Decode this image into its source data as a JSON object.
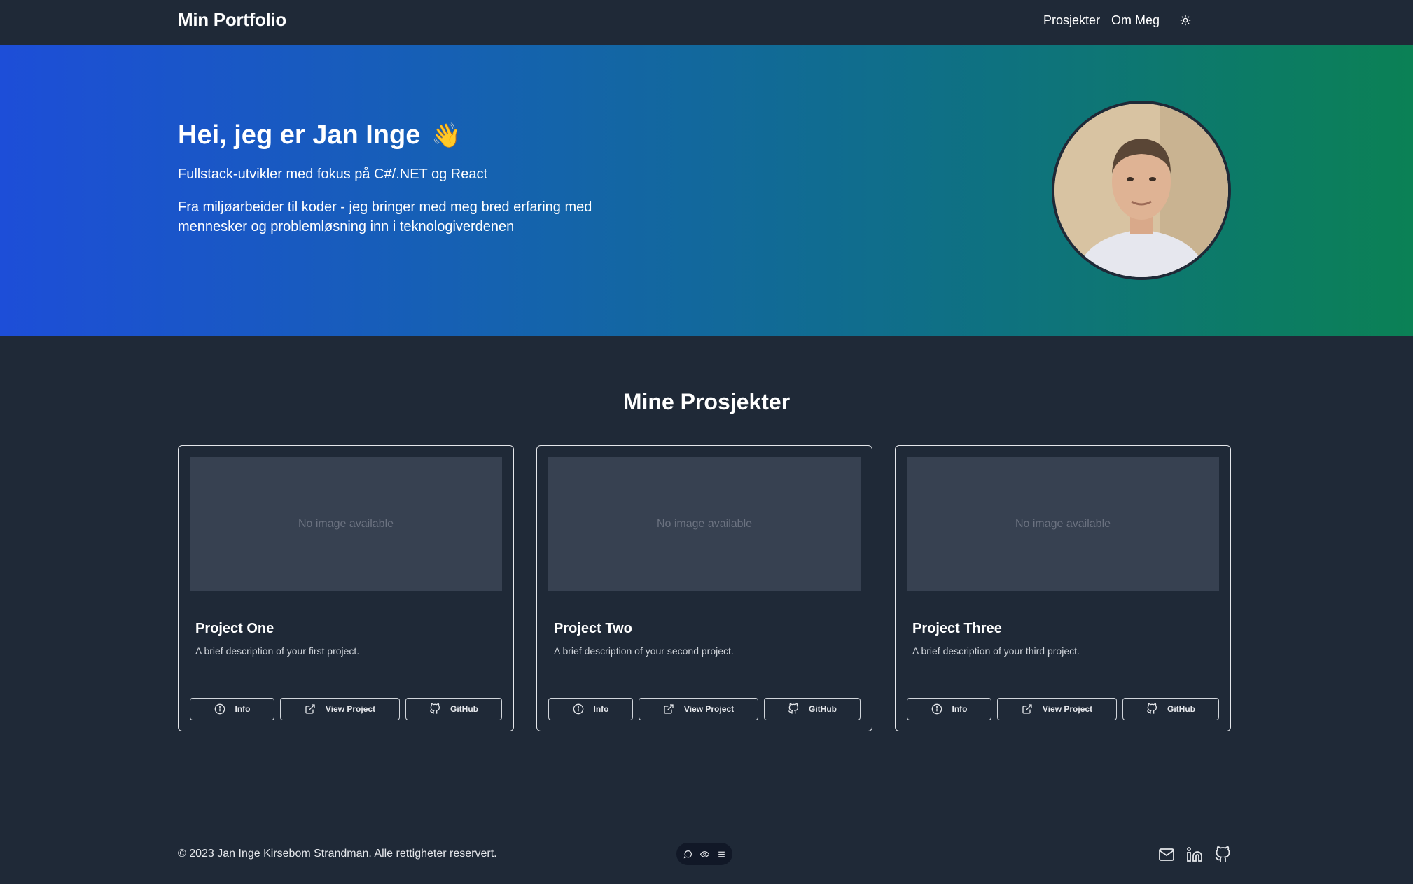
{
  "navbar": {
    "brand": "Min Portfolio",
    "links": [
      "Prosjekter",
      "Om Meg"
    ],
    "theme_icon": "sun-icon"
  },
  "hero": {
    "title": "Hei, jeg er Jan Inge",
    "emoji": "👋",
    "subtitle": "Fullstack-utvikler med fokus på C#/.NET og React",
    "text": "Fra miljøarbeider til koder - jeg bringer med meg bred erfaring med mennesker og problemløsning inn i teknologiverdenen",
    "avatar": "profile-photo",
    "gradient": [
      "#1d4ed8",
      "#0b8155"
    ]
  },
  "projects": {
    "title": "Mine Prosjekter",
    "placeholder": "No image available",
    "buttons": {
      "info": "Info",
      "view": "View Project",
      "github": "GitHub"
    },
    "items": [
      {
        "title": "Project One",
        "description": "A brief description of your first project."
      },
      {
        "title": "Project Two",
        "description": "A brief description of your second project."
      },
      {
        "title": "Project Three",
        "description": "A brief description of your third project."
      }
    ]
  },
  "footer": {
    "copyright": "© 2023 Jan Inge Kirsebom Strandman. Alle rettigheter reservert.",
    "icons": [
      "mail-icon",
      "linkedin-icon",
      "github-icon"
    ],
    "floating_toolbar_icons": [
      "chat-icon",
      "eye-icon",
      "menu-icon"
    ]
  },
  "colors": {
    "background": "#1f2937",
    "card_image": "#374151",
    "text": "#ffffff"
  }
}
